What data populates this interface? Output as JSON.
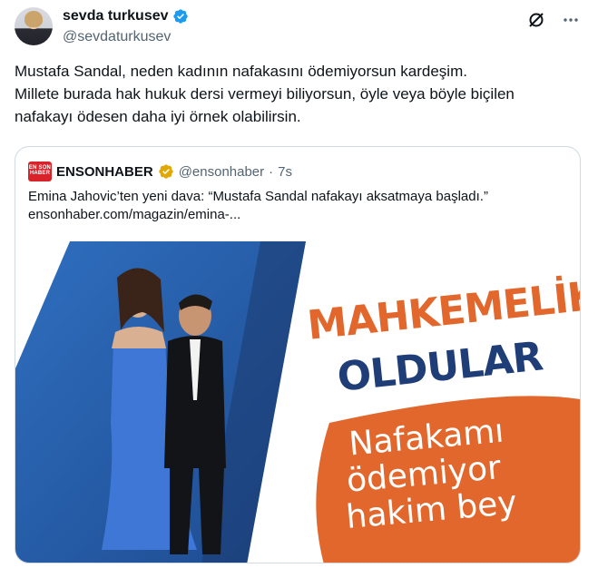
{
  "author": {
    "name": "sevda turkusev",
    "handle": "@sevdaturkusev",
    "verified_color": "#1d9bf0"
  },
  "actions": {
    "grok_icon": "grok-icon",
    "more_icon": "more-icon",
    "more_label": "···"
  },
  "tweet": {
    "lines": [
      "Mustafa Sandal, neden kadının nafakasını ödemiyorsun kardeşim.",
      "Millete burada hak hukuk dersi vermeyi biliyorsun, öyle veya böyle biçilen",
      "nafakayı ödesen daha iyi örnek olabilirsin."
    ]
  },
  "quote": {
    "logo_text": "EN SON HABER",
    "name": "ENSONHABER",
    "handle": "@ensonhaber",
    "separator": "·",
    "time": "7s",
    "text_line1": "Emina Jahovic’ten yeni dava: “Mustafa Sandal nafakayı aksatmaya başladı.”",
    "link": "ensonhaber.com/magazin/emina-...",
    "badge_color": "#e0a800"
  },
  "media": {
    "headline_1": "MAHKEMELİK",
    "headline_2": "OLDULAR",
    "quote_line_1": "Nafakamı",
    "quote_line_2": "ödemiyor",
    "quote_line_3": "hakim bey",
    "accent_orange": "#e2672c",
    "navy": "#1f3d77"
  }
}
